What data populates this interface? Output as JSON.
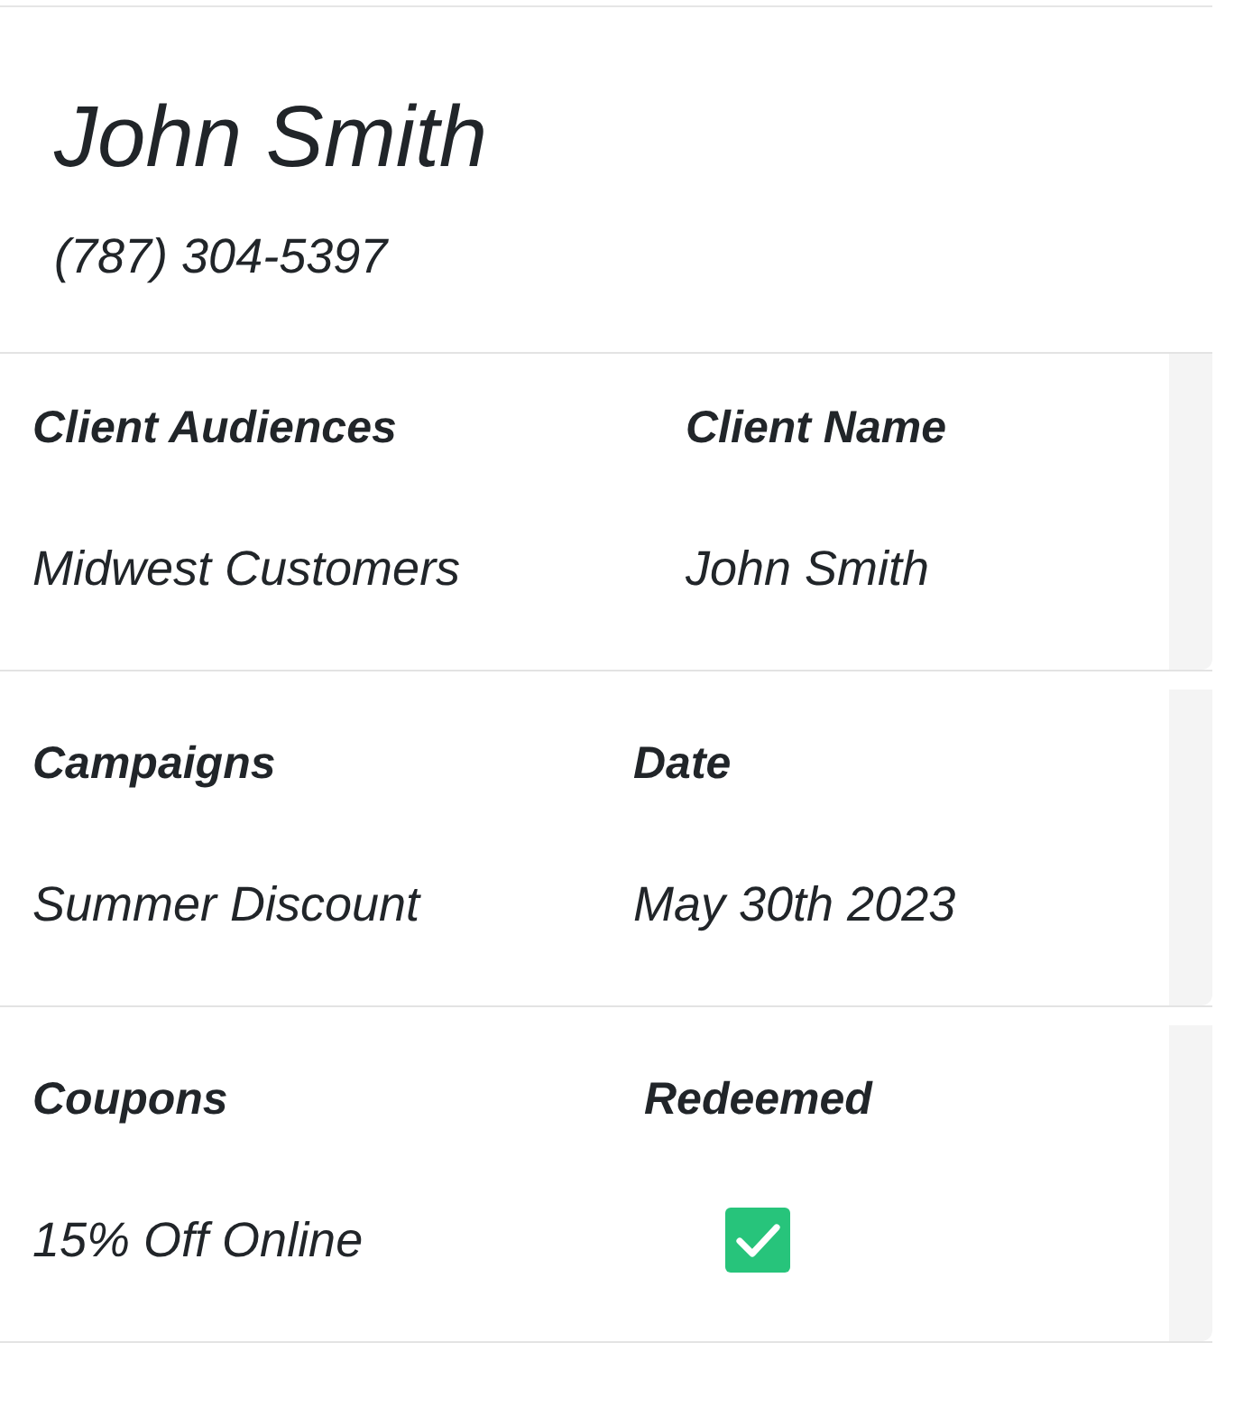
{
  "contact": {
    "name": "John Smith",
    "phone": "(787) 304-5397"
  },
  "sections": [
    {
      "fields": [
        {
          "kind": "text",
          "label": "Client Audiences",
          "value": "Midwest Customers"
        },
        {
          "kind": "text",
          "label": "Client Name",
          "value": "John Smith"
        }
      ]
    },
    {
      "fields": [
        {
          "kind": "text",
          "label": "Campaigns",
          "value": "Summer Discount"
        },
        {
          "kind": "text",
          "label": "Date",
          "value": "May 30th 2023"
        }
      ]
    },
    {
      "fields": [
        {
          "kind": "text",
          "label": "Coupons",
          "value": "15% Off Online"
        },
        {
          "kind": "checkbox",
          "label": "Redeemed",
          "checked": true
        }
      ]
    }
  ]
}
